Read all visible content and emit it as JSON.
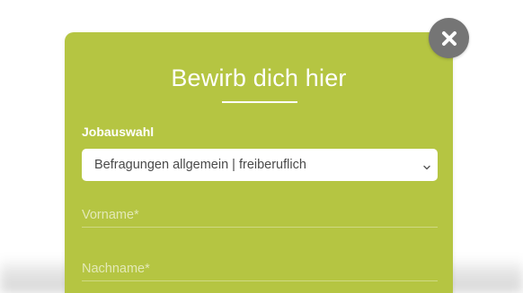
{
  "modal": {
    "title": "Bewirb dich hier",
    "accent_color": "#b5c542",
    "job_select": {
      "label": "Jobauswahl",
      "selected_value": "Befragungen allgemein | freiberuflich",
      "icon": "chevron-down-icon"
    },
    "fields": [
      {
        "placeholder": "Vorname*"
      },
      {
        "placeholder": "Nachname*"
      }
    ]
  },
  "close_button": {
    "icon": "close-icon",
    "color": "#757575"
  }
}
